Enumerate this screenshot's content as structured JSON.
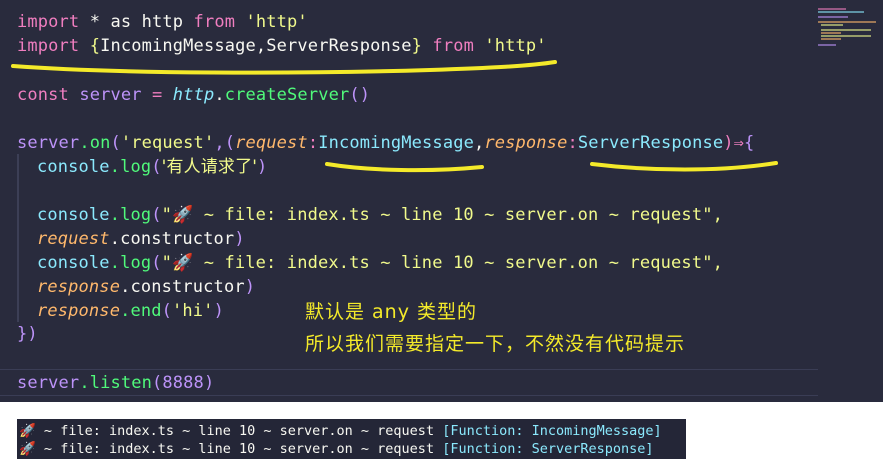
{
  "code": {
    "import_kw": "import",
    "star_as": " * as ",
    "http_ident": "http",
    "from_kw": " from ",
    "http_str": "'http'",
    "import2_kw": "import",
    "open_brace": " {",
    "incoming": "IncomingMessage",
    "comma": ",",
    "server_response": "ServerResponse",
    "close_brace": "}",
    "from2_kw": " from ",
    "http_str2": "'http'",
    "const_kw": "const",
    "server_var": " server",
    "eq": " = ",
    "http_obj": "http",
    "dot": ".",
    "create_server": "createServer",
    "empty_parens": "()",
    "server_on": "server",
    "on_fn": ".on",
    "on_open": "(",
    "request_str": "'request'",
    "cb_open": ",(",
    "p_request": "request",
    "colon1": ":",
    "t_incoming": "IncomingMessage",
    "comma2": ",",
    "p_response": "response",
    "colon2": ":",
    "t_server_response": "ServerResponse",
    "arrow": ")⇒",
    "brace_open": "{",
    "console1": "console",
    "log1": ".log",
    "log1_open": "(",
    "log1_str": "'有人请求了'",
    "log1_close": ")",
    "console2": "console",
    "log2": ".log",
    "log2_open": "(",
    "log2_str": "\"🚀 ~ file: index.ts ~ line 10 ~ server.on ~ request\",",
    "req_obj": "request",
    "req_ctor": ".constructor",
    "req_close": ")",
    "console3": "console",
    "log3": ".log",
    "log3_open": "(",
    "log3_str": "\"🚀 ~ file: index.ts ~ line 10 ~ server.on ~ request\",",
    "res_obj": "response",
    "res_ctor": ".constructor",
    "res_close": ")",
    "res_obj2": "response",
    "end_fn": ".end",
    "end_open": "(",
    "end_str": "'hi'",
    "end_close": ")",
    "close_all": "})",
    "listen_server": "server",
    "listen_fn": ".listen",
    "listen_open": "(",
    "listen_port": "8888",
    "listen_close": ")"
  },
  "annotation": {
    "line1": "默认是 any 类型的",
    "line2": "所以我们需要指定一下，不然没有代码提示"
  },
  "terminal": {
    "line1_prefix": "🚀 ~ file: index.ts ~ line 10 ~ server.on ~ request ",
    "line1_value": "[Function: IncomingMessage]",
    "line2_prefix": "🚀 ~ file: index.ts ~ line 10 ~ server.on ~ request ",
    "line2_value": "[Function: ServerResponse]"
  },
  "colors": {
    "editor_bg": "#292b3d",
    "annotation": "#f4ea2a",
    "keyword": "#f07ec0",
    "type": "#8be9fd",
    "string": "#f1fa8c",
    "param": "#ffb86c"
  }
}
